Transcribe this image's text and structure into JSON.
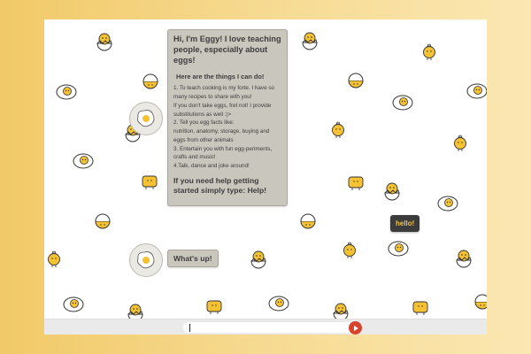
{
  "colors": {
    "bubble": "#c9c6bd",
    "user_bubble": "#3b3b3b",
    "user_text": "#f2c24a",
    "send_button": "#d9432c",
    "yolk": "#f5c234"
  },
  "chat": {
    "intro": {
      "greeting": "Hi, I'm Eggy! I love teaching people, especially about eggs!",
      "capabilities_title": "Here are the things I can do!",
      "lines": [
        "1. To teach cooking is my forte. I have so",
        "many recipes to share with you!",
        "If you don't take eggs, fret not! I provide",
        "substitutions as well :)>",
        "2. Tell you egg facts like:",
        "nutrition, anatomy, storage, buying and",
        "eggs from other animals",
        "3. Entertain you with fun egg-periments,",
        "crafts and music!",
        "4.Talk, dance and joke around!"
      ],
      "help_prompt": "If you need help getting started simply type: Help!"
    },
    "user_message": "hello!",
    "bot_reply": "What's up!"
  },
  "input": {
    "value": "",
    "placeholder": ""
  },
  "icons": {
    "bot_avatar": "fried-egg-icon",
    "send": "play-arrow-icon",
    "background": "cartoon-egg-pattern"
  }
}
